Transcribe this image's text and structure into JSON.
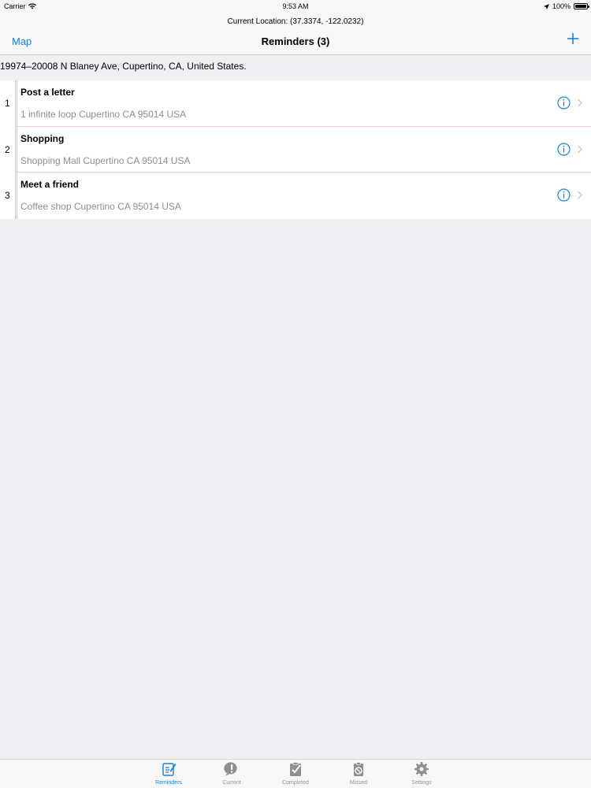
{
  "status": {
    "carrier": "Carrier",
    "time": "9:53 AM",
    "battery": "100%"
  },
  "nav": {
    "subtitle": "Current Location: (37.3374, -122.0232)",
    "left_label": "Map",
    "title": "Reminders (3)"
  },
  "address": "19974–20008 N Blaney Ave, Cupertino, CA, United States.",
  "reminders": [
    {
      "index": "1",
      "title": "Post a letter",
      "location": "1 infinite loop Cupertino CA 95014 USA"
    },
    {
      "index": "2",
      "title": "Shopping",
      "location": "Shopping Mall Cupertino CA 95014 USA"
    },
    {
      "index": "3",
      "title": "Meet a friend",
      "location": "Coffee shop Cupertino CA 95014 USA"
    }
  ],
  "tabs": [
    {
      "label": "Reminders",
      "icon": "reminders-icon",
      "active": true
    },
    {
      "label": "Current",
      "icon": "current-icon",
      "active": false
    },
    {
      "label": "Completed",
      "icon": "completed-icon",
      "active": false
    },
    {
      "label": "Missed",
      "icon": "missed-icon",
      "active": false
    },
    {
      "label": "Settings",
      "icon": "settings-icon",
      "active": false
    }
  ],
  "colors": {
    "accent": "#1a82d6",
    "background": "#efeff4",
    "secondary_text": "#8e8e93",
    "row_line": "#f3b8c0"
  }
}
